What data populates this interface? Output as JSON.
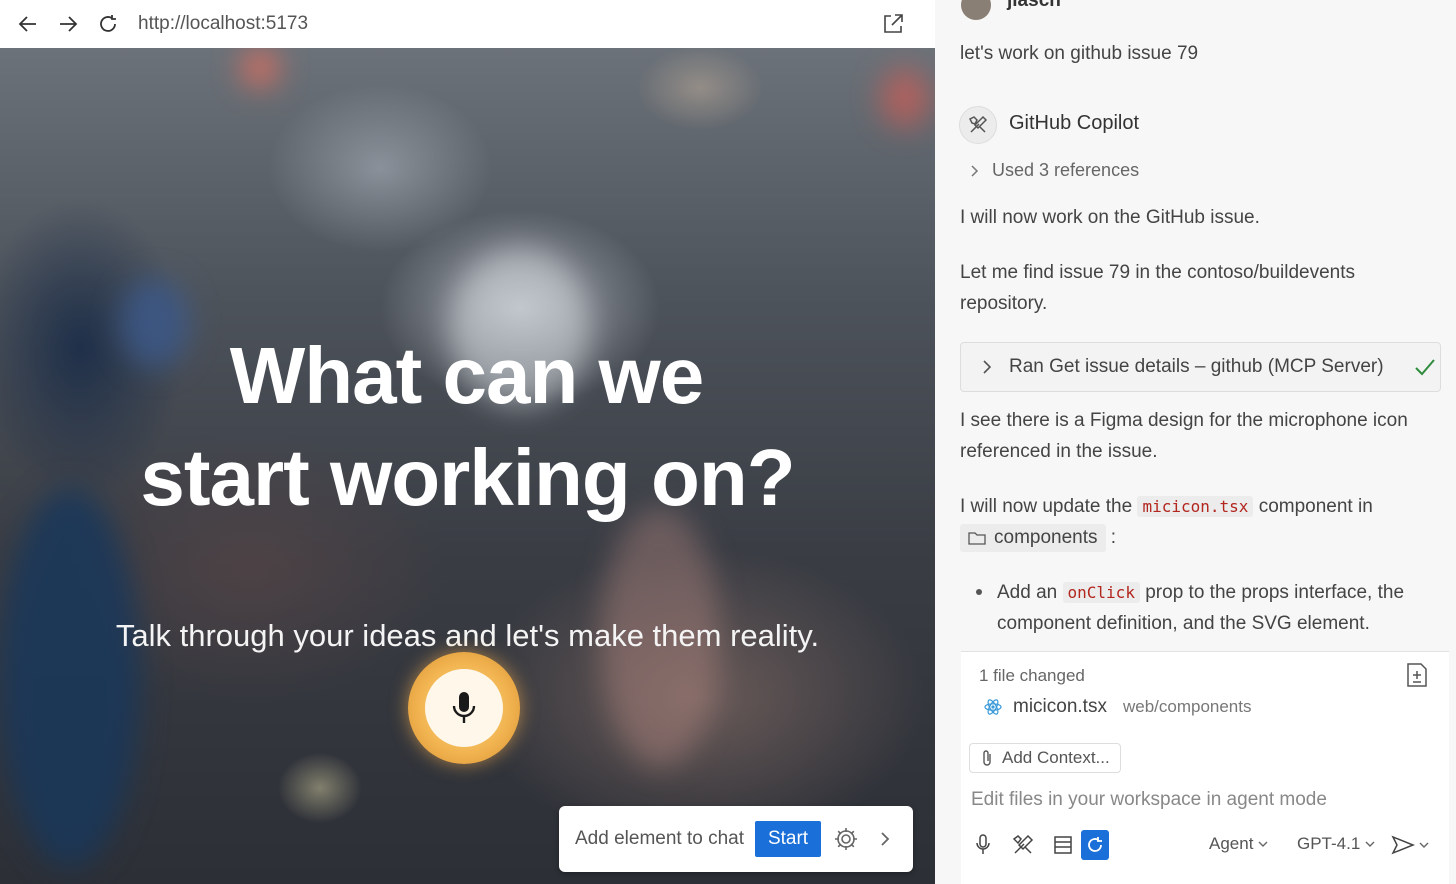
{
  "browser": {
    "url": "http://localhost:5173",
    "page": {
      "headline_line1": "What can we",
      "headline_line2": "start working on?",
      "subline": "Talk through your ideas and let's make them reality.",
      "mic_icon": "microphone-icon"
    },
    "element_bar": {
      "label": "Add element to chat",
      "start_label": "Start"
    }
  },
  "chat": {
    "user": {
      "name": "jlasch",
      "message": "let's work on github issue 79"
    },
    "assistant": {
      "name": "GitHub Copilot",
      "references": "Used 3 references",
      "p1": "I will now work on the GitHub issue.",
      "p2": "Let me find issue 79 in the contoso/buildevents repository.",
      "tool_call": "Ran Get issue details – github (MCP Server)",
      "p3": "I see there is a Figma design for the microphone icon referenced in the issue.",
      "p4_prefix": "I will now update the",
      "p4_code": "micicon.tsx",
      "p4_suffix": "component in",
      "p4_folder": "components",
      "p4_colon": ":",
      "bullet_prefix": "Add an",
      "bullet_code": "onClick",
      "bullet_suffix": "prop to the props interface, the component definition, and the SVG element."
    },
    "changes": {
      "count_label": "1 file changed",
      "file_name": "micicon.tsx",
      "file_path": "web/components"
    },
    "input": {
      "add_context": "Add Context...",
      "placeholder": "Edit files in your workspace in agent mode",
      "mode": "Agent",
      "model": "GPT-4.1"
    }
  }
}
